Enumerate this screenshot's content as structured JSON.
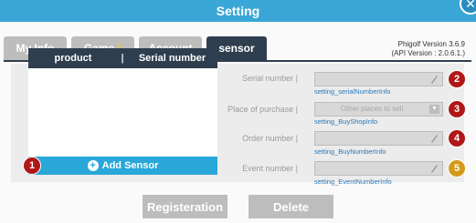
{
  "window": {
    "title": "Setting"
  },
  "tabs": [
    {
      "label": "My Info"
    },
    {
      "label": "Game",
      "mark": "!"
    },
    {
      "label": "Account"
    },
    {
      "label": "sensor"
    }
  ],
  "version": {
    "line1": "Phigolf Version 3.6.9",
    "line2": "(API Version : 2.0.6.1.)"
  },
  "sensor_table": {
    "columns": [
      "product",
      "Serial number"
    ],
    "separator": "|",
    "rows": []
  },
  "add_button": {
    "label": "Add Sensor"
  },
  "fields": [
    {
      "badge": "2",
      "label": "Serial number",
      "key": "setting_serialNumberInfo",
      "value": ""
    },
    {
      "badge": "3",
      "label": "Place of purchase",
      "key": "setting_BuyShopInfo",
      "value": "Other places to sell"
    },
    {
      "badge": "4",
      "label": "Order number",
      "key": "setting_BuyNumberInfo",
      "value": ""
    },
    {
      "badge": "5",
      "label": "Event number",
      "key": "setting_EventNumberInfo",
      "value": ""
    }
  ],
  "field_separator": "|",
  "left_badge": "1",
  "buttons": {
    "register": "Registeration",
    "delete": "Delete"
  },
  "colors": {
    "titlebar": "#3aa7d6",
    "active_tab": "#2f3e4e",
    "add_button": "#29a7d8",
    "badge_red": "#b01717",
    "badge_gold": "#d29a17",
    "key_text": "#2a78b8"
  },
  "icons": {
    "close": "close-icon",
    "plus": "plus-circle-icon",
    "pencil": "pencil-icon",
    "dropdown": "chevron-down-icon"
  }
}
